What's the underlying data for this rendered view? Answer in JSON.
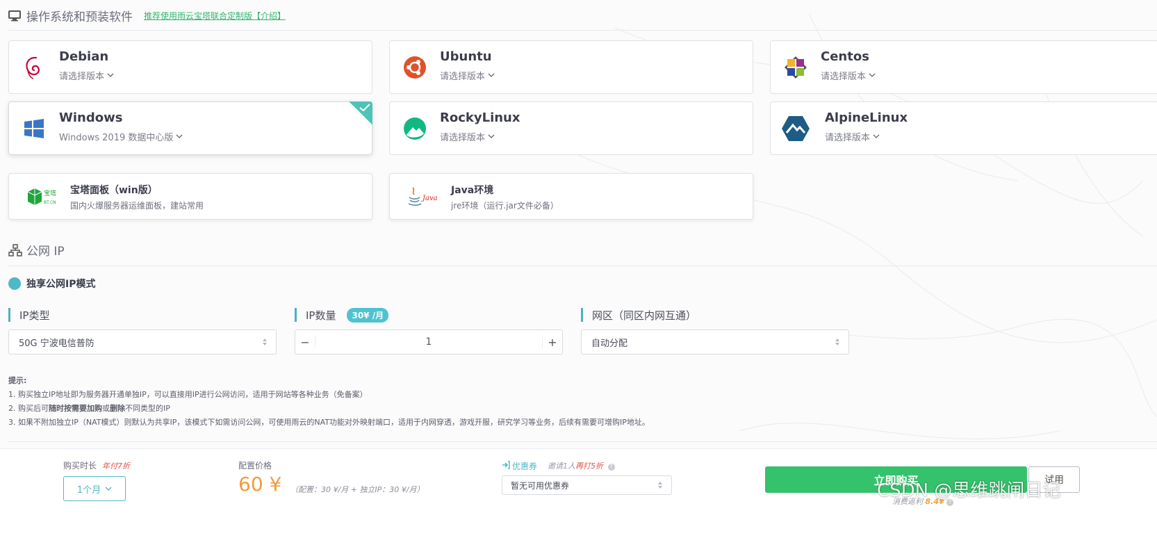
{
  "os_section": {
    "title": "操作系统和预装软件",
    "link": "推荐使用雨云宝塔联合定制版【介绍】"
  },
  "os_cards": [
    {
      "name": "Debian",
      "version": "请选择版本",
      "icon": "debian-icon"
    },
    {
      "name": "Ubuntu",
      "version": "请选择版本",
      "icon": "ubuntu-icon"
    },
    {
      "name": "Centos",
      "version": "请选择版本",
      "icon": "centos-icon"
    },
    {
      "name": "Windows",
      "version": "Windows 2019 数据中心版",
      "icon": "windows-icon",
      "selected": true
    },
    {
      "name": "RockyLinux",
      "version": "请选择版本",
      "icon": "rockylinux-icon"
    },
    {
      "name": "AlpineLinux",
      "version": "请选择版本",
      "icon": "alpinelinux-icon"
    }
  ],
  "app_cards": [
    {
      "name": "宝塔面板（win版）",
      "desc": "国内火爆服务器运维面板，建站常用",
      "icon": "bt-panel-icon",
      "logo_text": "宝塔",
      "logo_sub": "BT.CN"
    },
    {
      "name": "Java环境",
      "desc": "jre环境（运行.jar文件必备）",
      "icon": "java-icon",
      "logo_text": "Java"
    }
  ],
  "ip_section": {
    "title": "公网 IP",
    "mode": "独享公网IP模式",
    "type_label": "IP类型",
    "type_value": "50G 宁波电信普防",
    "count_label": "IP数量",
    "count_price": "30¥ /月",
    "count_value": "1",
    "zone_label": "网区（同区内网互通）",
    "zone_value": "自动分配"
  },
  "tips": {
    "title": "提示:",
    "line1": "1. 购买独立IP地址即为服务器开通单独IP，可以直接用IP进行公网访问，适用于网站等各种业务（免备案）",
    "line2_pre": "2. 购买后可",
    "line2_bold1": "随时按需要加购",
    "line2_mid": "或",
    "line2_bold2": "删除",
    "line2_post": "不同类型的IP",
    "line3": "3. 如果不附加独立IP（NAT模式）则默认为共享IP，该模式下如需访问公网，可使用雨云的NAT功能对外映射端口，适用于内网穿透，游戏开服，研究学习等业务，后续有需要可增购IP地址。"
  },
  "footer": {
    "duration_label": "购买时长",
    "duration_discount": "年付7折",
    "duration_value": "1个月",
    "price_label": "配置价格",
    "price": "60 ¥",
    "price_detail": "（配置：30 ¥/月 + 独立IP：30 ¥/月）",
    "coupon_label": "优惠券",
    "invite_pre": "邀请1人",
    "invite_red": "再打5折",
    "coupon_value": "暂无可用优惠券",
    "buy_label": "立即购买",
    "trial_label": "试用",
    "rebate_pre": "消费返利",
    "rebate_amount": "8.4¥"
  },
  "watermark": "CSDN @思维跳闸日记",
  "colors": {
    "accent_teal": "#4fb8c6",
    "buy_green": "#35c26c",
    "price_orange": "#f39a3b",
    "discount_red": "#e4504c"
  }
}
